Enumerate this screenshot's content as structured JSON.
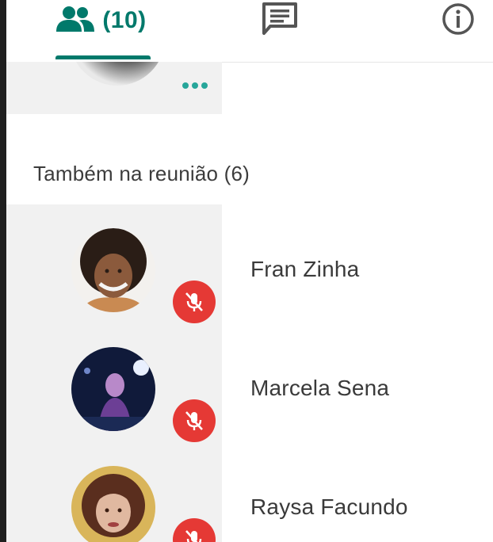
{
  "tabs": {
    "people": {
      "icon": "people-icon",
      "count_label": "(10)",
      "color": "#00796b",
      "selected": true
    },
    "chat": {
      "icon": "chat-icon"
    },
    "info": {
      "icon": "info-icon"
    }
  },
  "top_tile": {
    "more_icon": "more-horiz-icon"
  },
  "section": {
    "title": "Também na reunião (6)"
  },
  "participants": [
    {
      "name": "Fran Zinha",
      "muted": true,
      "mute_icon": "mic-off-icon"
    },
    {
      "name": "Marcela Sena",
      "muted": true,
      "mute_icon": "mic-off-icon"
    },
    {
      "name": "Raysa Facundo",
      "muted": true,
      "mute_icon": "mic-off-icon"
    }
  ],
  "colors": {
    "accent": "#00796b",
    "accent_dots": "#26a69a",
    "mute_badge": "#e53935",
    "tile_bg": "#f1f1f1"
  }
}
